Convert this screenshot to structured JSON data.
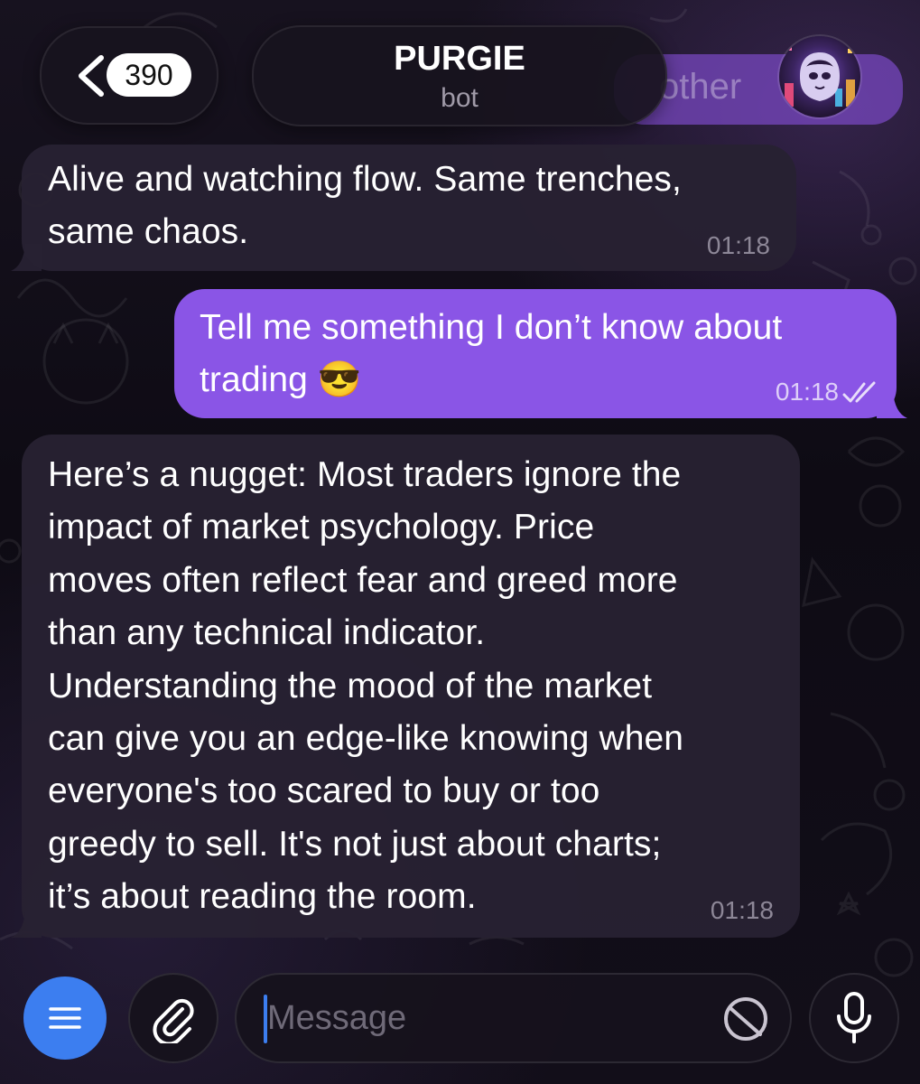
{
  "header": {
    "back_count": "390",
    "title": "PURGIE",
    "subtitle": "bot",
    "background_bubble_text": "other",
    "icons": {
      "back": "chevron-left-icon",
      "avatar": "bot-avatar"
    }
  },
  "messages": [
    {
      "direction": "incoming",
      "text": "Alive and watching flow. Same trenches,\nsame chaos.",
      "time": "01:18"
    },
    {
      "direction": "outgoing",
      "text": "Tell me something I don’t know about\ntrading 😎",
      "time": "01:18",
      "status": "read"
    },
    {
      "direction": "incoming",
      "text": "Here’s a nugget: Most traders ignore the\nimpact of market psychology. Price\nmoves often reflect fear and greed more\nthan any technical indicator.\nUnderstanding the mood of the market\ncan give you an edge-like knowing when\neveryone's too scared to buy or too\ngreedy to sell. It's not just about charts;\nit’s about reading the room.",
      "time": "01:18"
    }
  ],
  "input_bar": {
    "placeholder": "Message",
    "value": "",
    "icons": {
      "menu": "menu-lines-icon",
      "attach": "paperclip-icon",
      "sticker": "sticker-icon",
      "mic": "microphone-icon"
    }
  },
  "colors": {
    "outgoing_bubble": "#8a55e6",
    "incoming_bubble": "#282132",
    "menu_button": "#3c7ef0",
    "caret": "#3c7ef0"
  }
}
